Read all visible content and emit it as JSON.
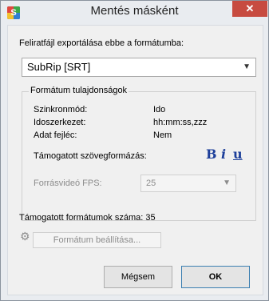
{
  "window": {
    "title": "Mentés másként",
    "close_glyph": "✕"
  },
  "main": {
    "prompt": "Feliratfájl exportálása ebbe a formátumba:",
    "format_selected": "SubRip [SRT]",
    "group_title": "Formátum tulajdonságok",
    "properties": [
      {
        "label": "Szinkronmód:",
        "value": "Ido"
      },
      {
        "label": "Idoszerkezet:",
        "value": "hh:mm:ss,zzz"
      },
      {
        "label": "Adat fejléc:",
        "value": "Nem"
      }
    ],
    "formatting_label": "Támogatott szövegformázás:",
    "formatting_buttons": {
      "bold": "B",
      "italic": "i",
      "underline": "u"
    },
    "fps_label": "Forrásvideó FPS:",
    "fps_value": "25",
    "supported_count_text": "Támogatott formátumok száma: 35",
    "format_settings_button": "Formátum beállítása..."
  },
  "buttons": {
    "cancel": "Mégsem",
    "ok": "OK"
  },
  "icons": {
    "app": "subtitle-app-icon",
    "gear": "gear-icon",
    "chevron": "chevron-down-icon"
  }
}
